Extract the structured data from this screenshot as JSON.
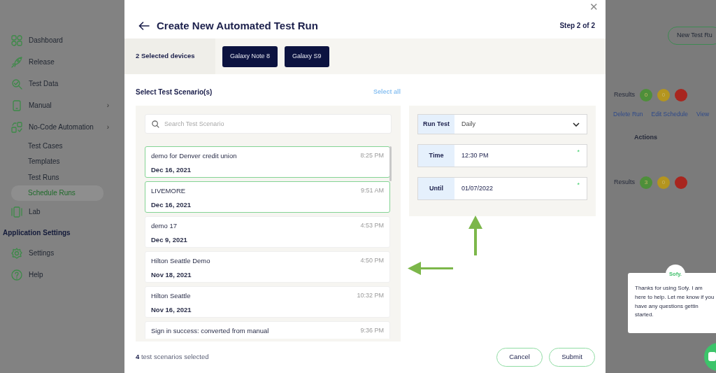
{
  "sidebar": {
    "items": [
      {
        "label": "Dashboard",
        "selected": false
      },
      {
        "label": "Release",
        "selected": false
      },
      {
        "label": "Test Data",
        "selected": false
      },
      {
        "label": "Manual",
        "selected": false,
        "chevron": "›"
      },
      {
        "label": "No-Code Automation",
        "selected": false,
        "chevron": "›",
        "children": [
          {
            "label": "Test Cases",
            "selected": false
          },
          {
            "label": "Templates",
            "selected": false
          },
          {
            "label": "Test Runs",
            "selected": false
          },
          {
            "label": "Schedule Runs",
            "selected": true
          }
        ]
      },
      {
        "label": "Lab",
        "selected": false
      }
    ],
    "section_title": "Application Settings",
    "settings_items": [
      {
        "label": "Settings",
        "selected": false
      },
      {
        "label": "Help",
        "selected": false
      }
    ]
  },
  "background": {
    "new_button": "New Test Ru",
    "runs": [
      {
        "results_label": "Results",
        "results": [
          {
            "value": "0",
            "color": "#4e8f3a"
          },
          {
            "value": "0",
            "color": "#b4951f"
          },
          {
            "color": "#a8261f"
          }
        ],
        "links": [
          "Delete Run",
          "Edit Schedule",
          "View"
        ],
        "actions_label": "Actions"
      },
      {
        "results_label": "Results",
        "results": [
          {
            "value": "3",
            "color": "#4e8f3a"
          },
          {
            "value": "0",
            "color": "#b4951f"
          },
          {
            "color": "#a8261f"
          }
        ]
      }
    ]
  },
  "modal": {
    "close": "✕",
    "title": "Create New Automated Test Run",
    "step": "Step 2 of 2",
    "devices": {
      "label": "2 Selected devices",
      "chips": [
        "Galaxy Note 8",
        "Galaxy S9"
      ]
    },
    "scenarios": {
      "heading": "Select Test Scenario(s)",
      "select_all": "Select all",
      "search": {
        "placeholder": "Search Test Scenario"
      },
      "items": [
        {
          "name": "demo for Denver credit union",
          "date": "Dec 16, 2021",
          "time": "8:25 PM",
          "selected": true
        },
        {
          "name": "LIVEMORE",
          "date": "Dec 16, 2021",
          "time": "9:51 AM",
          "selected": true
        },
        {
          "name": "demo 17",
          "date": "Dec 9, 2021",
          "time": "4:53 PM",
          "selected": false
        },
        {
          "name": "Hilton Seattle Demo",
          "date": "Nov 18, 2021",
          "time": "4:50 PM",
          "selected": false
        },
        {
          "name": "Hilton Seattle",
          "date": "Nov 16, 2021",
          "time": "10:32 PM",
          "selected": false
        },
        {
          "name": "Sign in success: converted from manual",
          "time": "9:36 PM",
          "selected": false
        }
      ]
    },
    "schedule": [
      {
        "kind": "select",
        "label": "Run Test",
        "value": "Daily"
      },
      {
        "kind": "text",
        "label": "Time",
        "value": "12:30 PM",
        "required_mark": "*"
      },
      {
        "kind": "text",
        "label": "Until",
        "value": "01/07/2022",
        "required_mark": "*"
      }
    ],
    "footer": {
      "summary": "**4** test scenarios selected",
      "buttons": [
        "Cancel",
        "Submit"
      ]
    }
  },
  "chat": {
    "logo": "Sofy.",
    "message": "Thanks for using Sofy. I am here to help. Let me know if you have any questions gettin started."
  }
}
